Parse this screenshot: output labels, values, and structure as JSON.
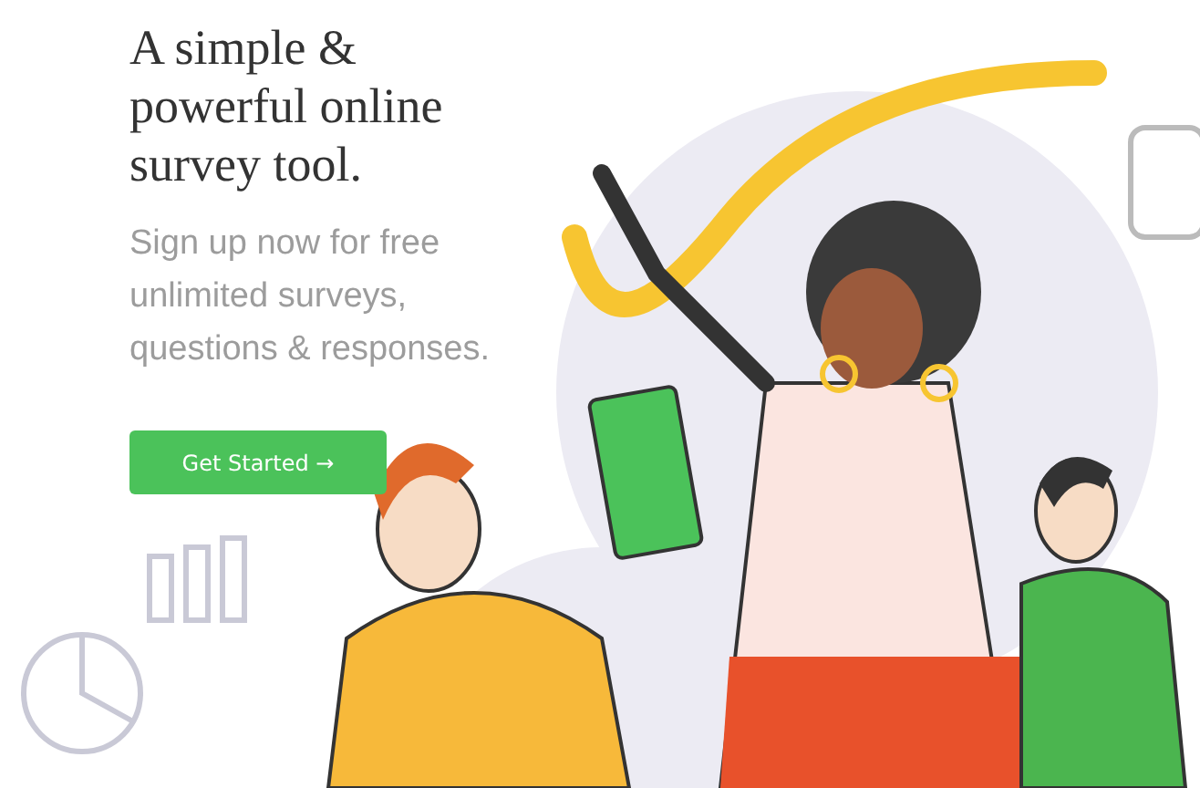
{
  "hero": {
    "headline": "A simple & powerful online survey tool.",
    "subheadline": "Sign up now for free unlimited surveys, questions & responses.",
    "cta_button": {
      "label": "Get Started →"
    }
  }
}
